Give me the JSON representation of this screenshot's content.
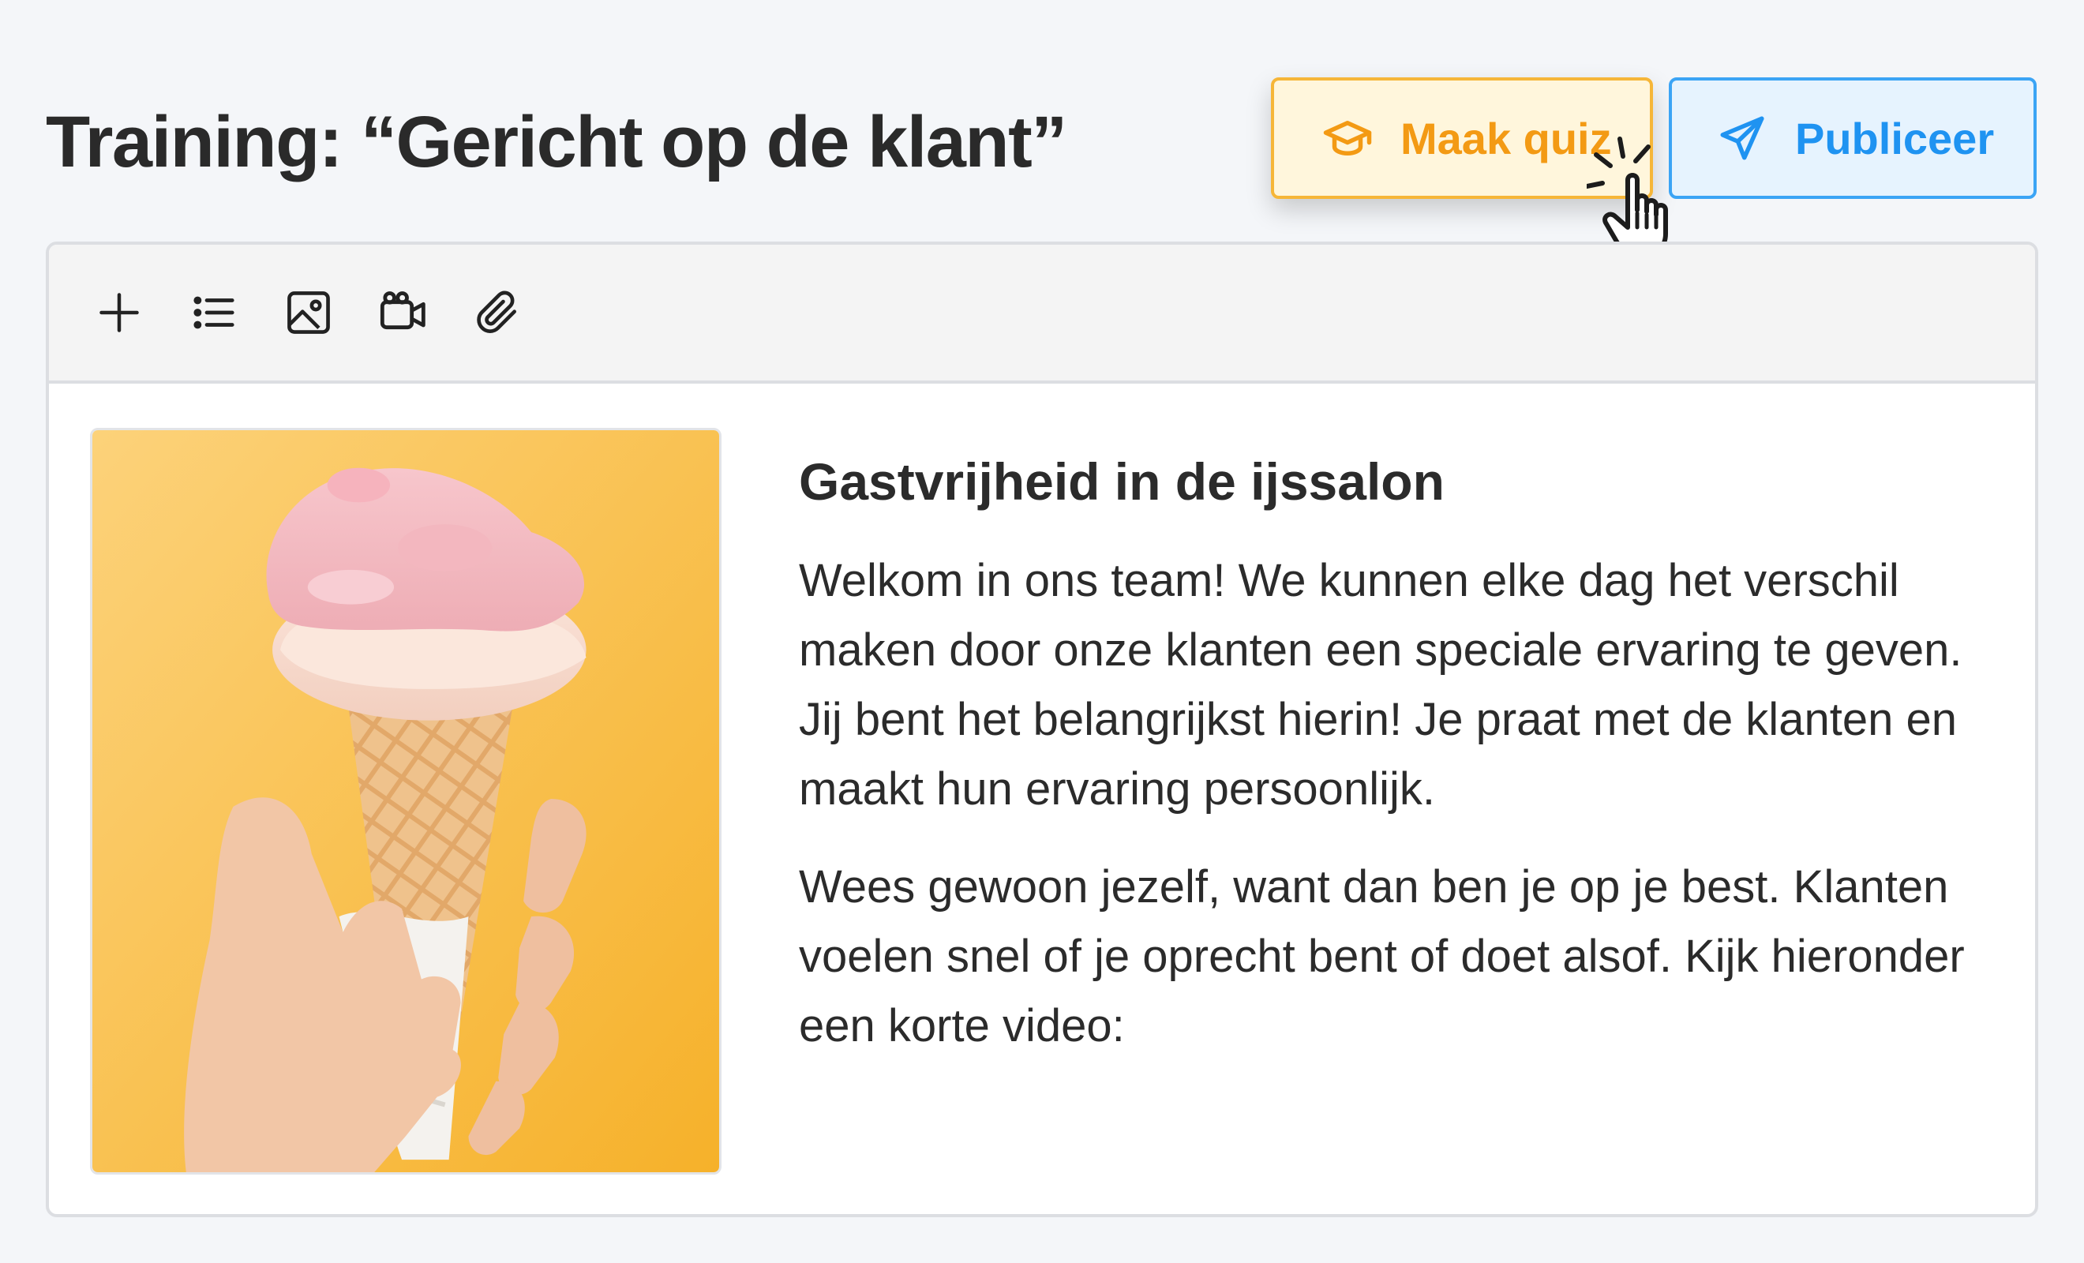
{
  "header": {
    "title": "Training: “Gericht op de klant”"
  },
  "actions": {
    "quiz_label": "Maak quiz",
    "publish_label": "Publiceer",
    "quiz_icon": "graduation-cap-icon",
    "publish_icon": "paper-plane-icon"
  },
  "toolbar": {
    "tools": [
      "plus-icon",
      "list-icon",
      "image-icon",
      "video-icon",
      "paperclip-icon"
    ]
  },
  "content": {
    "image": "ice-cream-cone-photo",
    "heading": "Gastvrijheid in de ijssalon",
    "paragraphs": [
      "Welkom in ons team! We kunnen elke dag het verschil maken door onze klanten een speciale ervaring te geven. Jij bent het belangrijkst hierin! Je praat met de klanten en maakt hun ervaring persoonlijk.",
      "Wees gewoon jezelf, want dan ben je op je best. Klanten voelen snel of je oprecht bent of doet alsof. Kijk hieronder een korte video:"
    ]
  },
  "colors": {
    "quiz_accent": "#f39a14",
    "publish_accent": "#1f93f1",
    "photo_background": "#f7b733"
  }
}
